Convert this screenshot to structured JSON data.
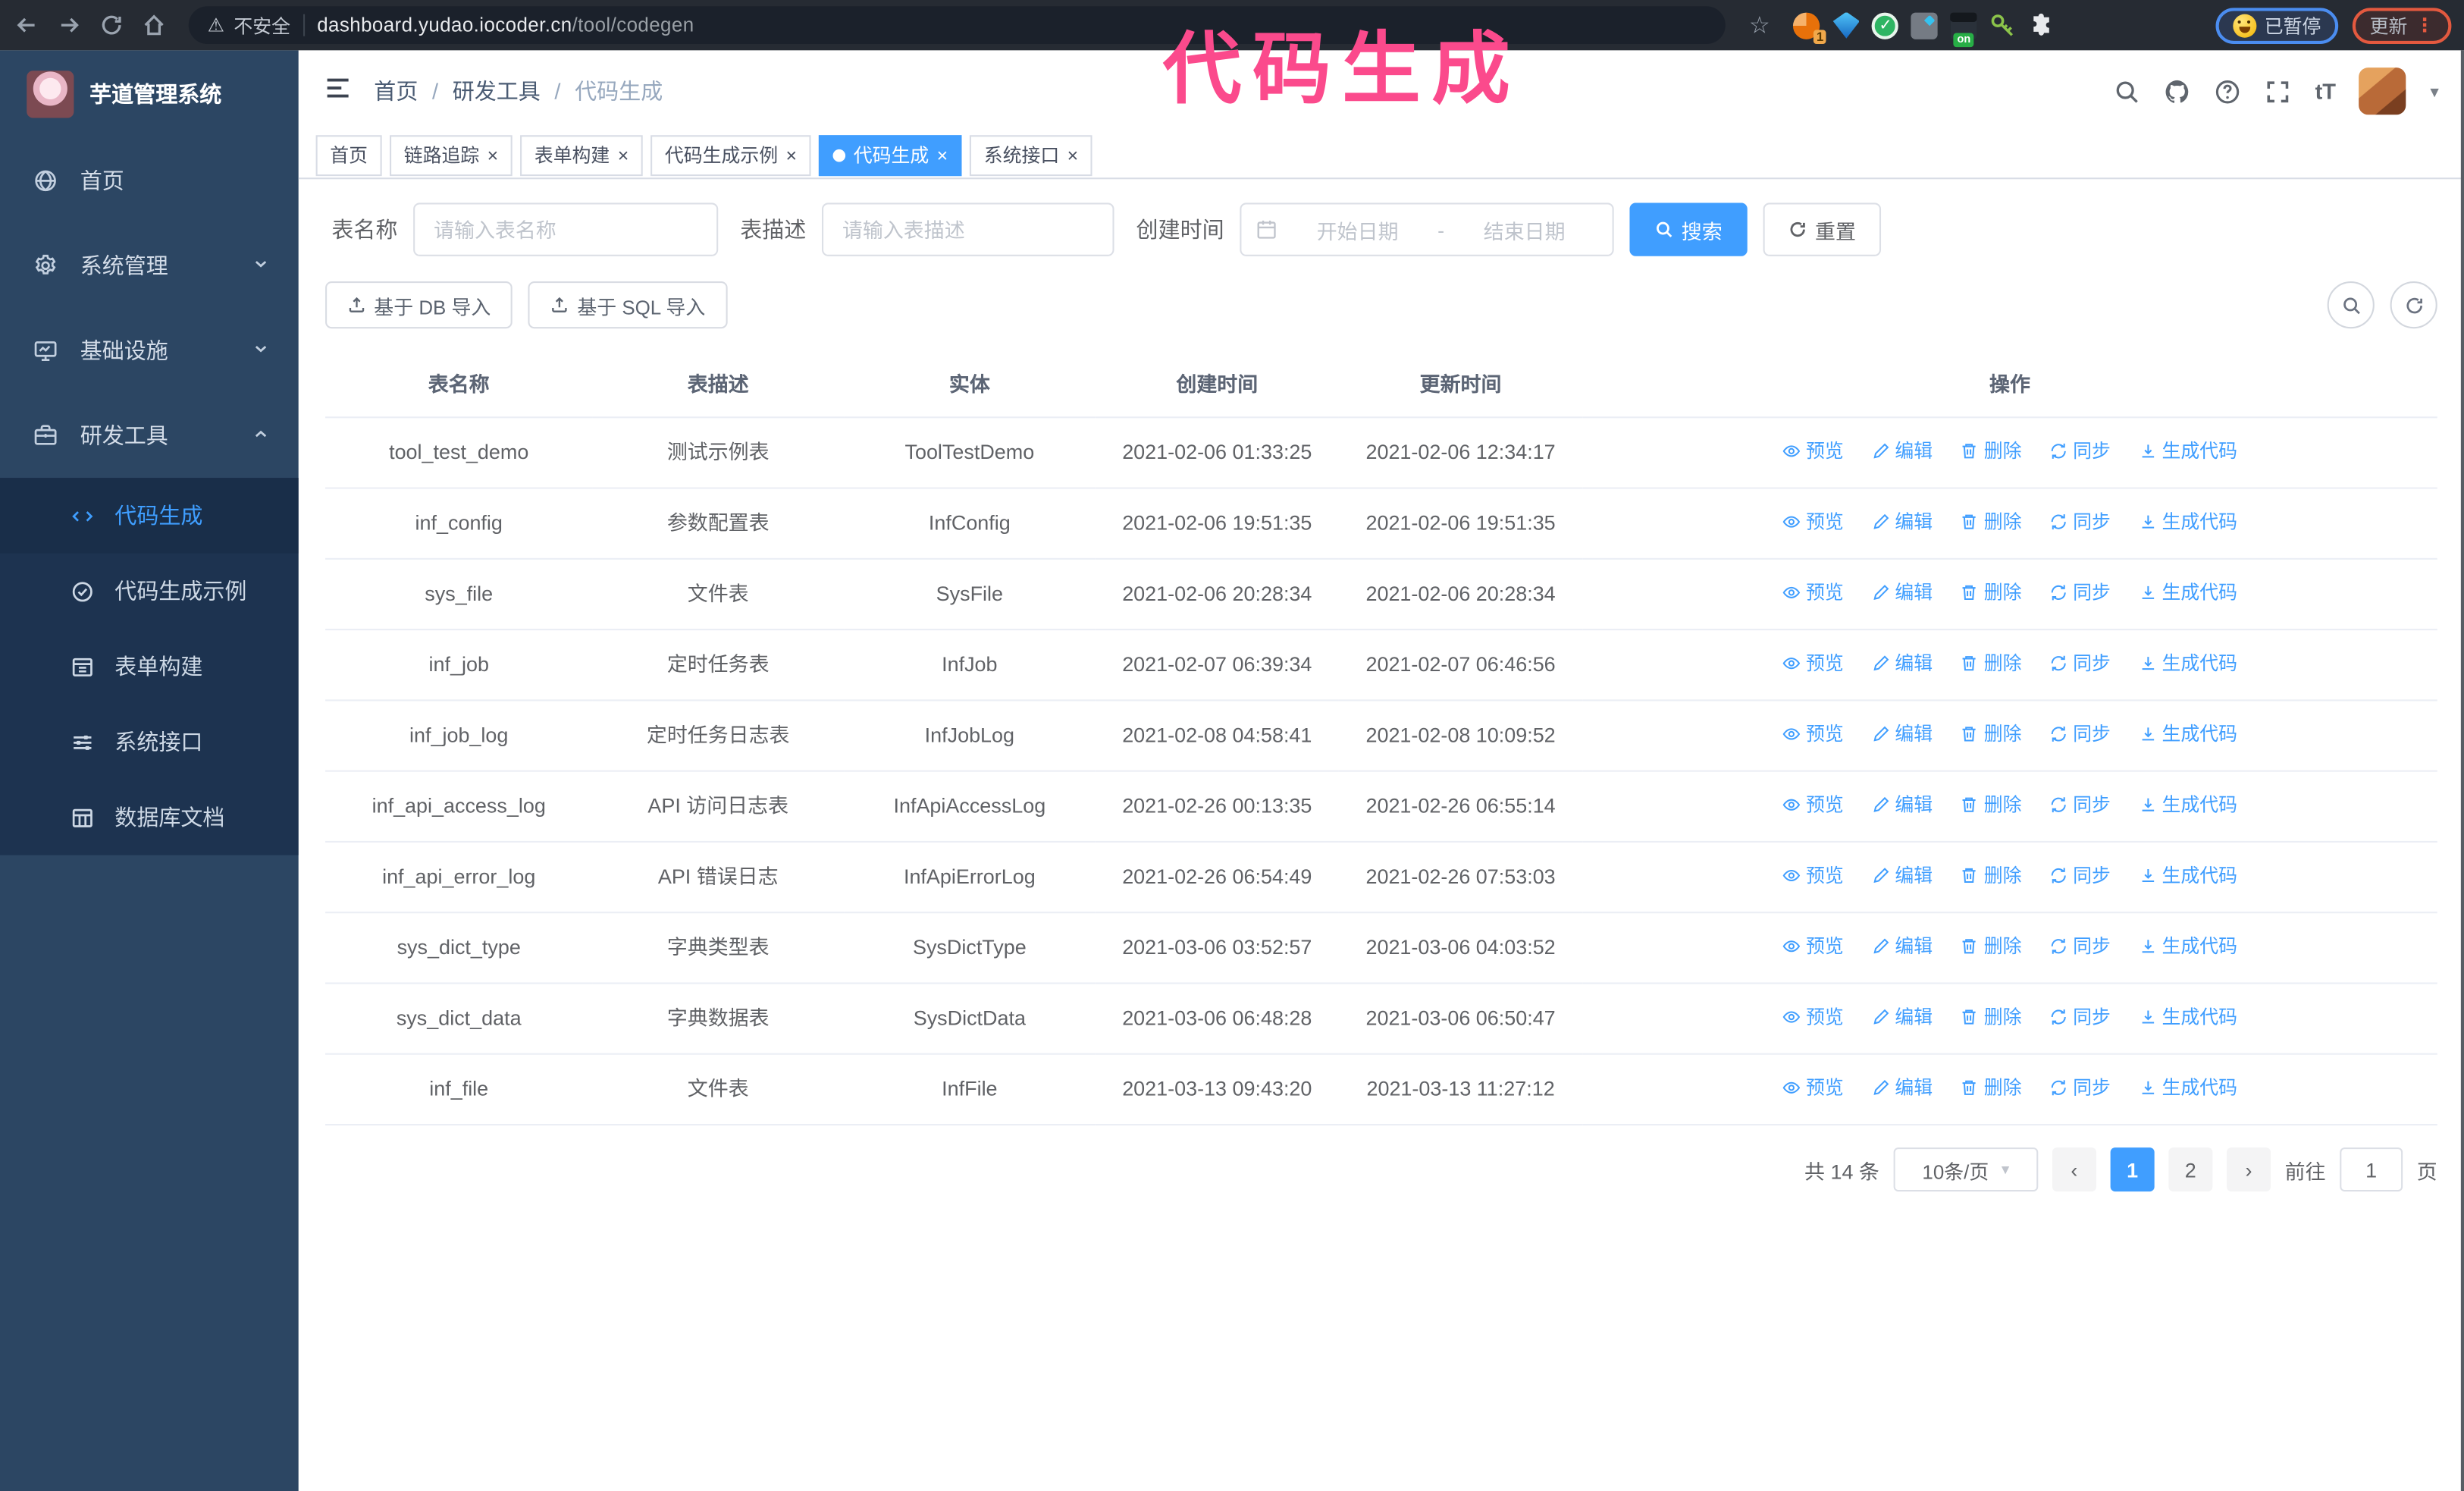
{
  "colors": {
    "accent": "#409eff",
    "sidebar_bg": "#2c4663",
    "submenu_bg": "#1d3350",
    "annotation_pink": "#fb4a8c",
    "chrome_bg": "#262b33"
  },
  "icons": {
    "close": "×",
    "caret_down": "▾",
    "chevron_left": "‹",
    "chevron_right": "›",
    "breadcrumb_separator": "/",
    "kebab": "⋮",
    "star": "☆",
    "warning": "⚠",
    "font_size": "tT"
  },
  "browser": {
    "security_label": "不安全",
    "url_host": "dashboard.yudao.iocoder.cn",
    "url_path": "/tool/codegen",
    "ext_orange_badge": "1",
    "ext_on_badge": "on",
    "paused_label": "已暂停",
    "update_label": "更新"
  },
  "annotation": {
    "text": "代码生成"
  },
  "sidebar": {
    "title": "芋道管理系统",
    "items": [
      {
        "label": "首页"
      },
      {
        "label": "系统管理"
      },
      {
        "label": "基础设施"
      },
      {
        "label": "研发工具"
      }
    ],
    "submenu": [
      {
        "label": "代码生成",
        "active": true
      },
      {
        "label": "代码生成示例"
      },
      {
        "label": "表单构建"
      },
      {
        "label": "系统接口"
      },
      {
        "label": "数据库文档"
      }
    ]
  },
  "header": {
    "breadcrumb": [
      "首页",
      "研发工具",
      "代码生成"
    ]
  },
  "tabs": [
    {
      "label": "首页",
      "closable": false,
      "active": false
    },
    {
      "label": "链路追踪",
      "closable": true,
      "active": false
    },
    {
      "label": "表单构建",
      "closable": true,
      "active": false
    },
    {
      "label": "代码生成示例",
      "closable": true,
      "active": false
    },
    {
      "label": "代码生成",
      "closable": true,
      "active": true
    },
    {
      "label": "系统接口",
      "closable": true,
      "active": false
    }
  ],
  "filters": {
    "name_label": "表名称",
    "name_placeholder": "请输入表名称",
    "desc_label": "表描述",
    "desc_placeholder": "请输入表描述",
    "time_label": "创建时间",
    "start_placeholder": "开始日期",
    "range_separator": "-",
    "end_placeholder": "结束日期",
    "search_label": "搜索",
    "reset_label": "重置"
  },
  "toolbar": {
    "db_import_label": "基于 DB 导入",
    "sql_import_label": "基于 SQL 导入"
  },
  "table": {
    "columns": [
      "表名称",
      "表描述",
      "实体",
      "创建时间",
      "更新时间",
      "操作"
    ],
    "actions": [
      "预览",
      "编辑",
      "删除",
      "同步",
      "生成代码"
    ],
    "rows": [
      {
        "name": "tool_test_demo",
        "desc": "测试示例表",
        "entity": "ToolTestDemo",
        "created": "2021-02-06 01:33:25",
        "updated": "2021-02-06 12:34:17"
      },
      {
        "name": "inf_config",
        "desc": "参数配置表",
        "entity": "InfConfig",
        "created": "2021-02-06 19:51:35",
        "updated": "2021-02-06 19:51:35"
      },
      {
        "name": "sys_file",
        "desc": "文件表",
        "entity": "SysFile",
        "created": "2021-02-06 20:28:34",
        "updated": "2021-02-06 20:28:34"
      },
      {
        "name": "inf_job",
        "desc": "定时任务表",
        "entity": "InfJob",
        "created": "2021-02-07 06:39:34",
        "updated": "2021-02-07 06:46:56"
      },
      {
        "name": "inf_job_log",
        "desc": "定时任务日志表",
        "entity": "InfJobLog",
        "created": "2021-02-08 04:58:41",
        "updated": "2021-02-08 10:09:52"
      },
      {
        "name": "inf_api_access_log",
        "desc": "API 访问日志表",
        "entity": "InfApiAccessLog",
        "created": "2021-02-26 00:13:35",
        "updated": "2021-02-26 06:55:14"
      },
      {
        "name": "inf_api_error_log",
        "desc": "API 错误日志",
        "entity": "InfApiErrorLog",
        "created": "2021-02-26 06:54:49",
        "updated": "2021-02-26 07:53:03"
      },
      {
        "name": "sys_dict_type",
        "desc": "字典类型表",
        "entity": "SysDictType",
        "created": "2021-03-06 03:52:57",
        "updated": "2021-03-06 04:03:52"
      },
      {
        "name": "sys_dict_data",
        "desc": "字典数据表",
        "entity": "SysDictData",
        "created": "2021-03-06 06:48:28",
        "updated": "2021-03-06 06:50:47"
      },
      {
        "name": "inf_file",
        "desc": "文件表",
        "entity": "InfFile",
        "created": "2021-03-13 09:43:20",
        "updated": "2021-03-13 11:27:12"
      }
    ]
  },
  "pagination": {
    "total_label": "共 14 条",
    "page_size_label": "10条/页",
    "pages": [
      "1",
      "2"
    ],
    "current_page": "1",
    "goto_label": "前往",
    "goto_value": "1",
    "page_unit": "页"
  }
}
